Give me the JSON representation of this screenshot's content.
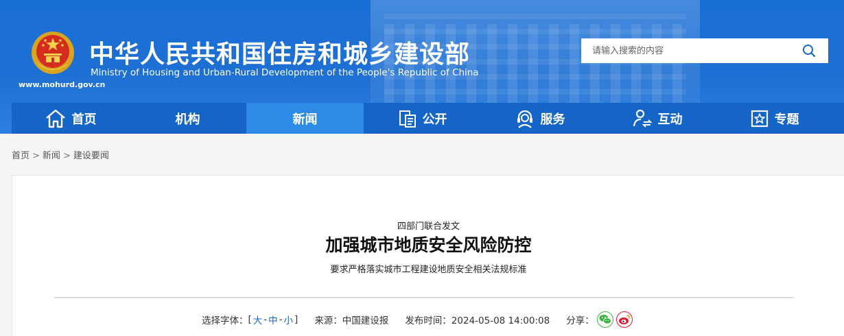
{
  "header": {
    "title_cn": "中华人民共和国住房和城乡建设部",
    "title_en": "Ministry of Housing and Urban-Rural Development of the People's Republic of China",
    "site_url": "www.mohurd.gov.cn",
    "search_placeholder": "请输入搜索的内容"
  },
  "nav": {
    "items": [
      {
        "label": "首页",
        "icon": "home-icon"
      },
      {
        "label": "机构",
        "icon": ""
      },
      {
        "label": "新闻",
        "icon": "",
        "active": true
      },
      {
        "label": "公开",
        "icon": "document-icon"
      },
      {
        "label": "服务",
        "icon": "service-icon"
      },
      {
        "label": "互动",
        "icon": "interaction-icon"
      },
      {
        "label": "专题",
        "icon": "star-icon"
      }
    ]
  },
  "breadcrumb": [
    "首页",
    "新闻",
    "建设要闻"
  ],
  "article": {
    "pretitle": "四部门联合发文",
    "title": "加强城市地质安全风险防控",
    "subtitle": "要求严格落实城市工程建设地质安全相关法规标准",
    "font_size_label": "选择字体：",
    "font_sizes": [
      "大",
      "中",
      "小"
    ],
    "source": "来源：中国建设报",
    "publish_time": "发布时间：2024-05-08 14:00:08",
    "share_label": "分享："
  },
  "colors": {
    "header_blue": "#1e6fd3",
    "nav_blue": "#1565c8",
    "nav_active": "#2f8ae6",
    "wechat_green": "#3fb33f",
    "weibo_red": "#e6162d"
  }
}
